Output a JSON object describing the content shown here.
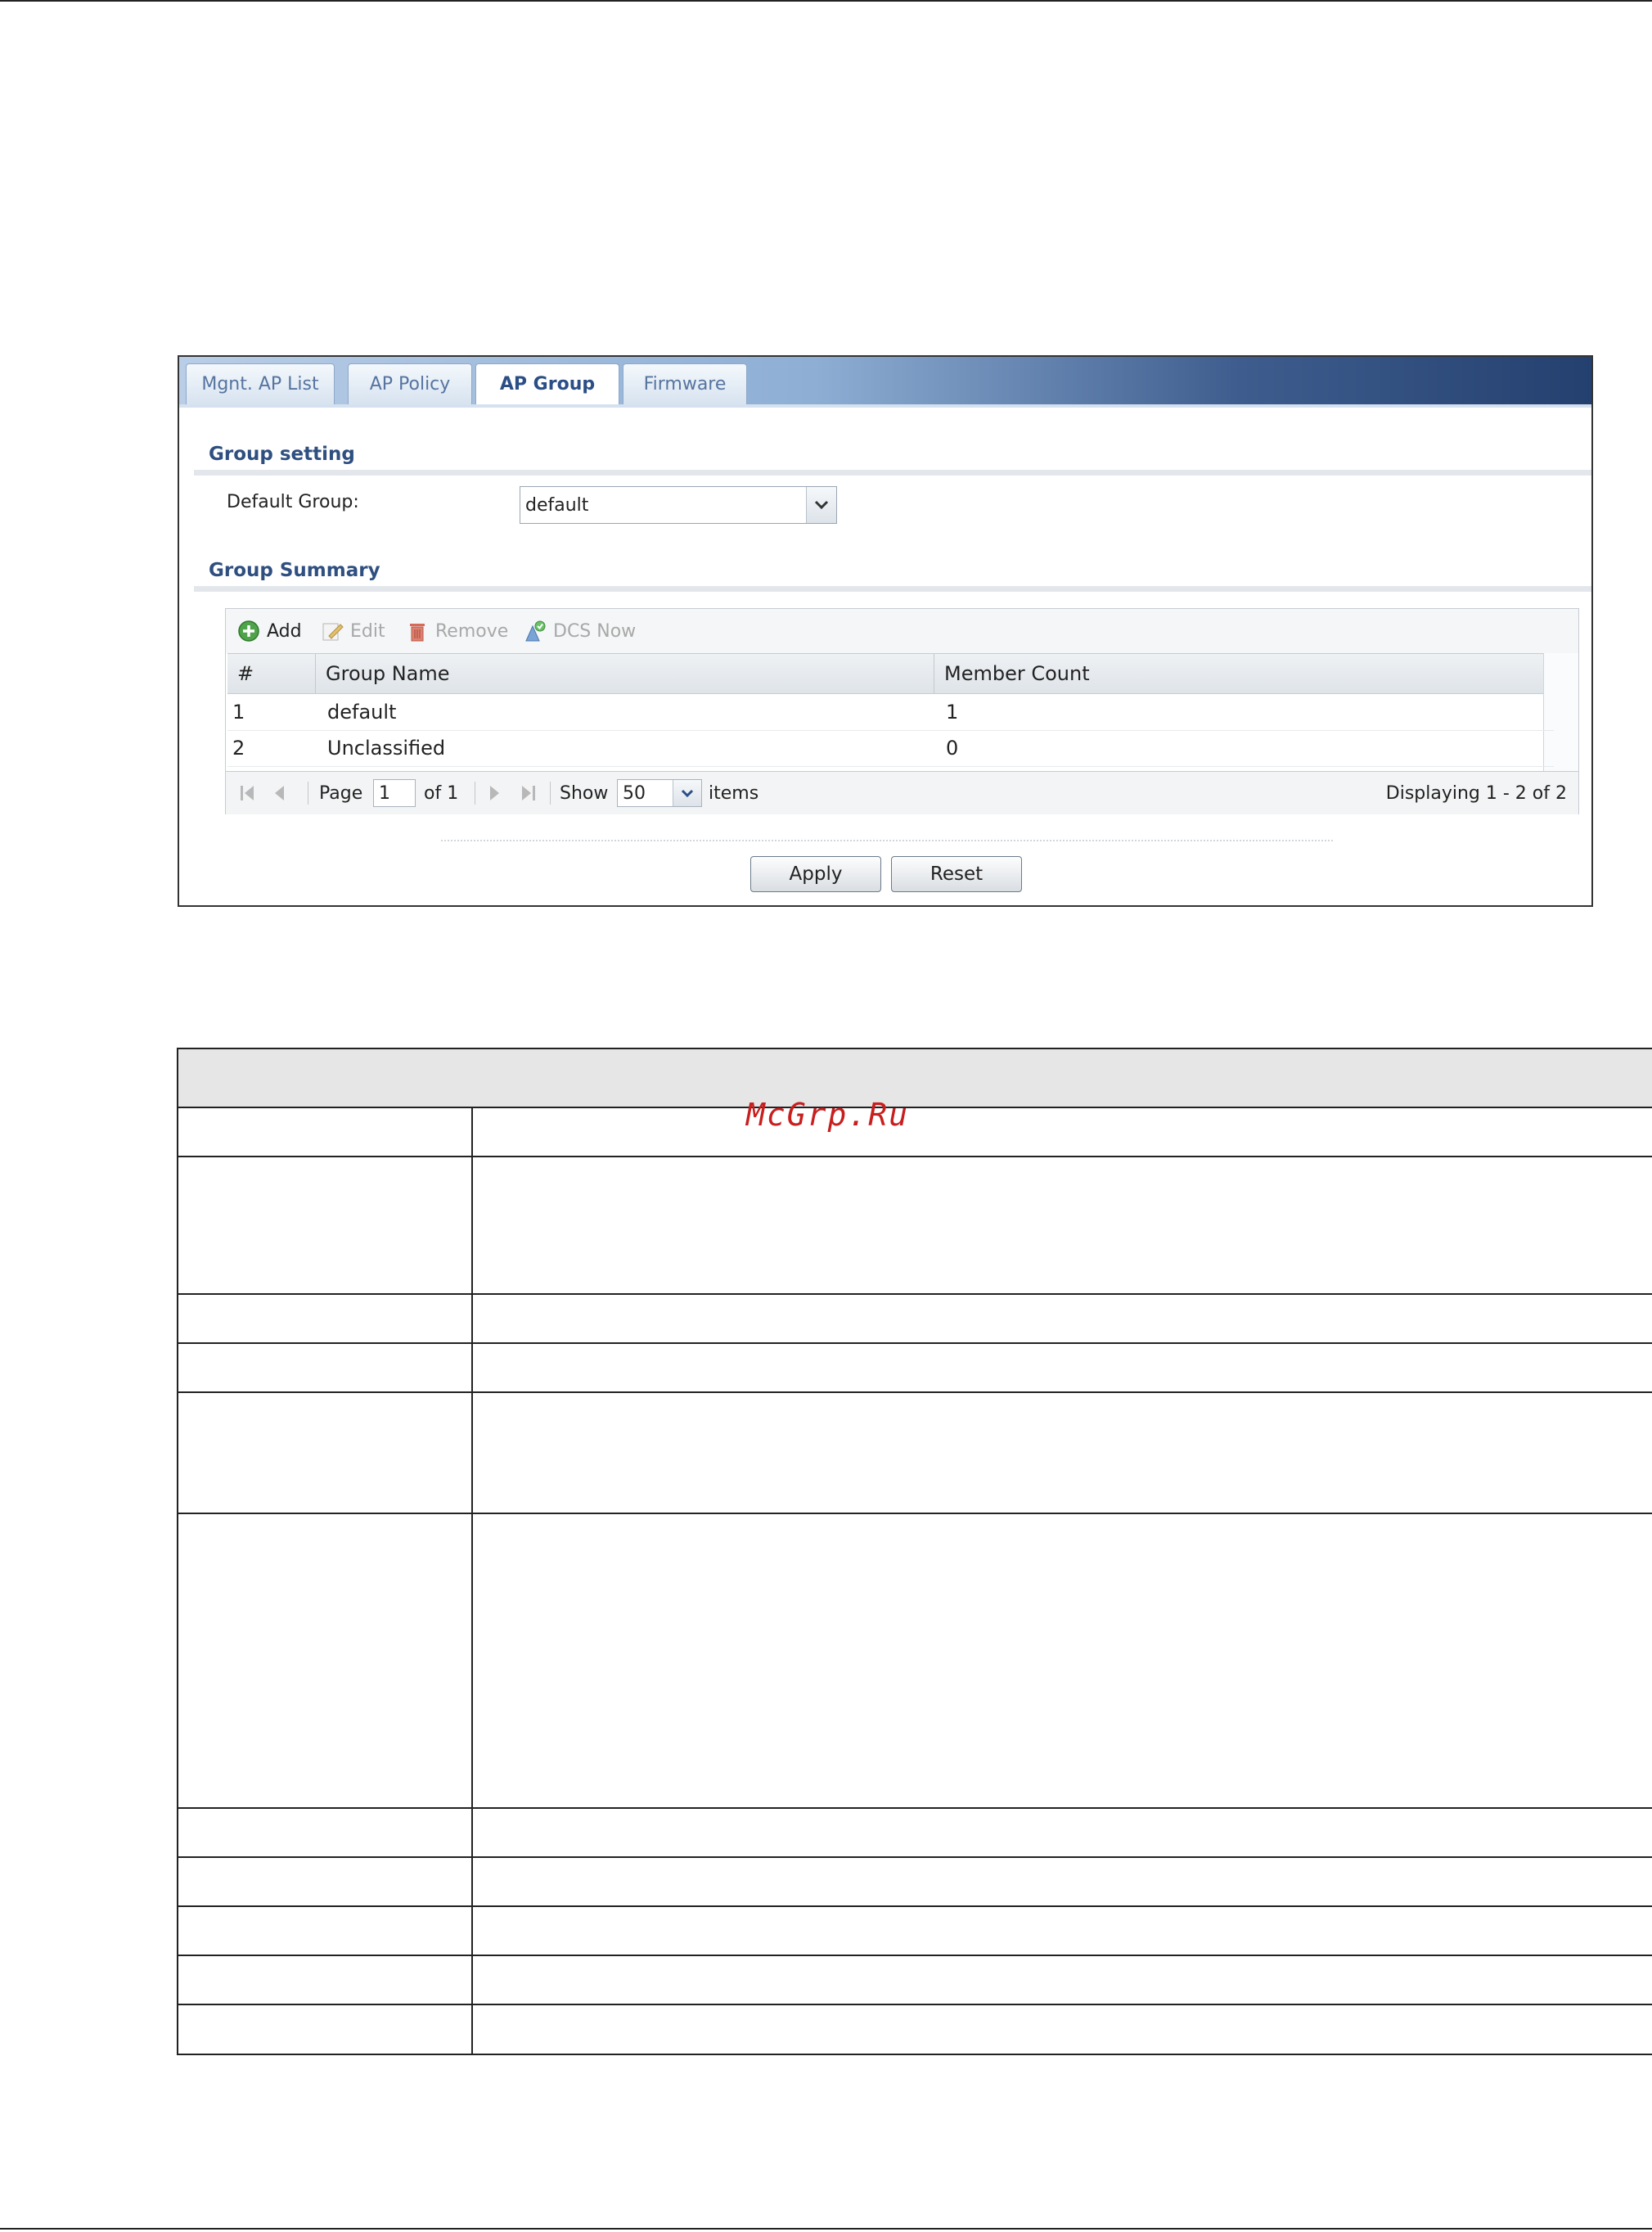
{
  "tabs": [
    {
      "label": "Mgnt. AP List",
      "active": false
    },
    {
      "label": "AP Policy",
      "active": false
    },
    {
      "label": "AP Group",
      "active": true
    },
    {
      "label": "Firmware",
      "active": false
    }
  ],
  "group_setting": {
    "title": "Group setting",
    "default_group_label": "Default Group:",
    "default_group_value": "default"
  },
  "group_summary": {
    "title": "Group Summary",
    "toolbar": {
      "add": "Add",
      "edit": "Edit",
      "remove": "Remove",
      "dcs_now": "DCS Now"
    },
    "columns": [
      "#",
      "Group Name",
      "Member Count"
    ],
    "rows": [
      {
        "index": "1",
        "name": "default",
        "count": "1"
      },
      {
        "index": "2",
        "name": "Unclassified",
        "count": "0"
      }
    ],
    "pager": {
      "page_label": "Page",
      "page_value": "1",
      "of_label": "of 1",
      "show_label": "Show",
      "show_value": "50",
      "items_label": "items",
      "displaying": "Displaying 1 - 2 of 2"
    }
  },
  "buttons": {
    "apply": "Apply",
    "reset": "Reset"
  },
  "watermark": "McGrp.Ru",
  "colors": {
    "accent": "#2e4f80",
    "tab_bar_dark": "#24406f",
    "watermark": "#c81e1e"
  }
}
